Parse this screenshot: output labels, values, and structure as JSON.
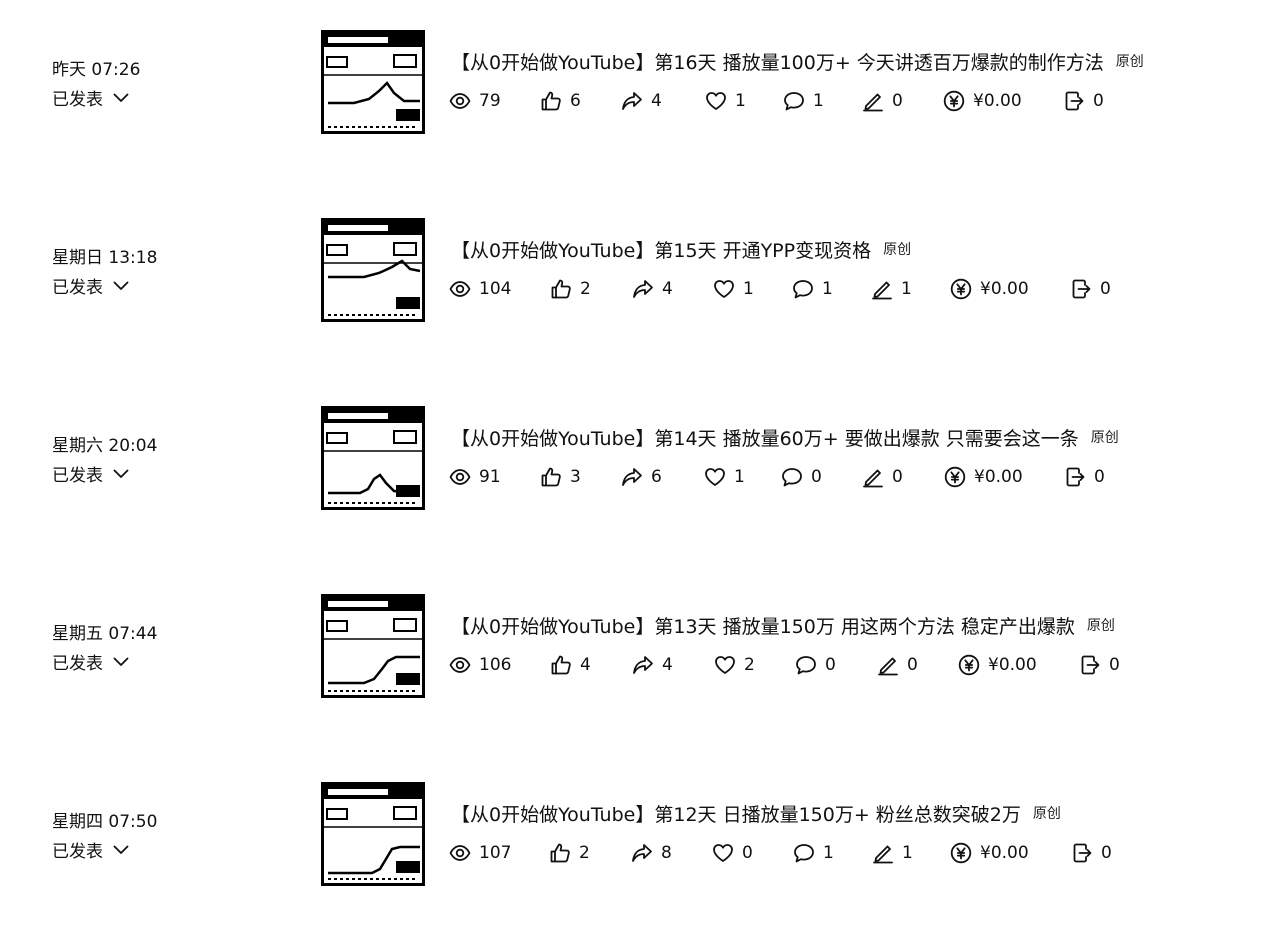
{
  "posts": [
    {
      "date": "昨天 07:26",
      "status": "已发表",
      "title": "【从0开始做YouTube】第16天 播放量100万+ 今天讲透百万爆款的制作方法",
      "tag": "原创",
      "stats": {
        "views": "79",
        "likes": "6",
        "shares": "4",
        "favorites": "1",
        "comments": "1",
        "notes": "0",
        "earnings": "¥0.00",
        "forwards": "0"
      }
    },
    {
      "date": "星期日 13:18",
      "status": "已发表",
      "title": "【从0开始做YouTube】第15天 开通YPP变现资格",
      "tag": "原创",
      "stats": {
        "views": "104",
        "likes": "2",
        "shares": "4",
        "favorites": "1",
        "comments": "1",
        "notes": "1",
        "earnings": "¥0.00",
        "forwards": "0"
      }
    },
    {
      "date": "星期六 20:04",
      "status": "已发表",
      "title": "【从0开始做YouTube】第14天 播放量60万+ 要做出爆款 只需要会这一条",
      "tag": "原创",
      "stats": {
        "views": "91",
        "likes": "3",
        "shares": "6",
        "favorites": "1",
        "comments": "0",
        "notes": "0",
        "earnings": "¥0.00",
        "forwards": "0"
      }
    },
    {
      "date": "星期五 07:44",
      "status": "已发表",
      "title": "【从0开始做YouTube】第13天 播放量150万 用这两个方法 稳定产出爆款",
      "tag": "原创",
      "stats": {
        "views": "106",
        "likes": "4",
        "shares": "4",
        "favorites": "2",
        "comments": "0",
        "notes": "0",
        "earnings": "¥0.00",
        "forwards": "0"
      }
    },
    {
      "date": "星期四 07:50",
      "status": "已发表",
      "title": "【从0开始做YouTube】第12天 日播放量150万+ 粉丝总数突破2万",
      "tag": "原创",
      "stats": {
        "views": "107",
        "likes": "2",
        "shares": "8",
        "favorites": "0",
        "comments": "1",
        "notes": "1",
        "earnings": "¥0.00",
        "forwards": "0"
      }
    }
  ],
  "icons": {
    "views": "eye-icon",
    "likes": "thumbs-up-icon",
    "shares": "share-arrow-icon",
    "favorites": "heart-icon",
    "comments": "comment-bubble-icon",
    "notes": "pen-icon",
    "earnings": "yuan-coin-icon",
    "forwards": "forward-icon",
    "status": "chevron-down-icon"
  }
}
